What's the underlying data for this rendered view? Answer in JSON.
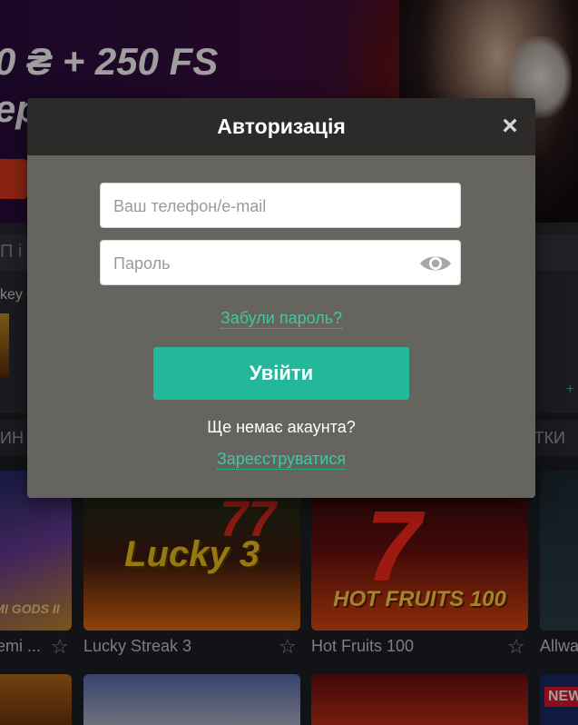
{
  "background": {
    "hero_line1": "0 ₴ + 250 FS",
    "hero_line2": "ер",
    "band_left_text": "П і",
    "band_key_text": "key",
    "tab_left_text": "ИН",
    "tab_right_text": "ТКИ",
    "plus_text": "+",
    "games": [
      {
        "name": "emi ...",
        "art": "MI GODS II"
      },
      {
        "name": "Lucky Streak 3",
        "art": "Lucky 3"
      },
      {
        "name": "Hot Fruits 100",
        "art": "HOT FRUITS 100"
      },
      {
        "name": "Allwa",
        "art": ""
      }
    ],
    "new_badge": "NEW",
    "star_icon": "☆"
  },
  "modal": {
    "title": "Авторизація",
    "close_icon": "×",
    "phone_placeholder": "Ваш телефон/e-mail",
    "password_placeholder": "Пароль",
    "forgot_password": "Забули пароль?",
    "login_button": "Увійти",
    "no_account_text": "Ще немає акаунта?",
    "register_link": "Зареєструватися"
  },
  "colors": {
    "accent": "#22b899",
    "link": "#3ec7a3",
    "modal_body": "#66645f",
    "modal_header": "#2d2b29"
  }
}
